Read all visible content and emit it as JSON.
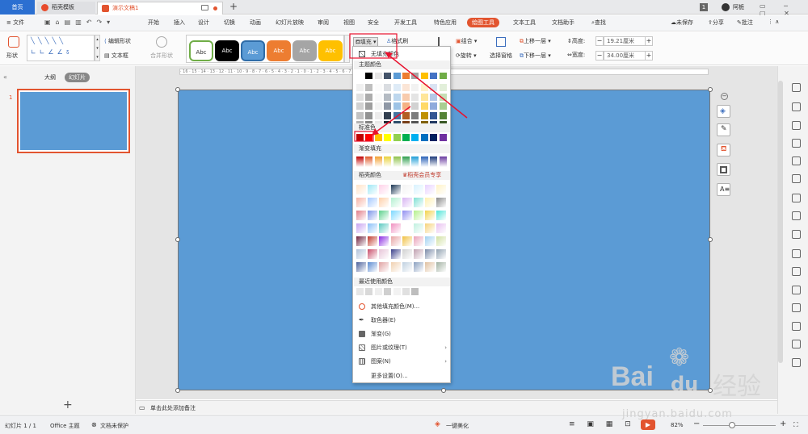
{
  "tabs": {
    "home": "首页",
    "template": "稻壳模板",
    "doc": "演示文稿1",
    "new_tab": "+",
    "page_badge": "1",
    "user": "阿栀"
  },
  "menu": {
    "file": "≡ 文件",
    "items": [
      "开始",
      "插入",
      "设计",
      "切换",
      "动画",
      "幻灯片放映",
      "审阅",
      "视图",
      "安全",
      "开发工具",
      "特色应用"
    ],
    "active": "绘图工具",
    "after": [
      "文本工具",
      "文档助手"
    ],
    "search": "查找",
    "unsaved": "未保存",
    "share": "分享",
    "comment": "批注"
  },
  "ribbon": {
    "shape": "形状",
    "edit_shape": "编辑形状",
    "textbox": "文本框",
    "merge": "合并形状",
    "styles": [
      "Abc",
      "Abc",
      "Abc",
      "Abc",
      "Abc",
      "Abc"
    ],
    "fill": "填充",
    "format_painter": "格式刷",
    "group": "组合",
    "rotate": "旋转",
    "select_pane": "选择窗格",
    "bring_forward": "上移一层",
    "send_backward": "下移一层",
    "height_label": "高度:",
    "height_value": "19.21厘米",
    "width_label": "宽度:",
    "width_value": "34.00厘米"
  },
  "left_panel": {
    "outline_tab": "大纲",
    "slides_tab": "幻灯片",
    "slide_number": "1",
    "add": "+"
  },
  "notes": "单击此处添加备注",
  "status": {
    "slide": "幻灯片 1 / 1",
    "theme": "Office 主题",
    "protect": "文档未保护",
    "beautify": "一键美化",
    "zoom": "82%"
  },
  "ruler": "· 16 · 15 · 14 · 13 · 12 · 11 · 10 · 9 · 8 · 7 · 6 · 5 · 4 · 3 · 2 · 1 · 0 · 1 · 2 · 3 · 4 · 5 · 6 · 7 · 8 · 9 · 10 · 11 · 12 · 13 · 14 · 15 · 16 ·",
  "dropdown": {
    "no_fill": "无填充颜色",
    "theme_colors": "主题颜色",
    "standard_colors": "标准色",
    "gradient_fill": "渐变填充",
    "docer_colors": "稻壳颜色",
    "docer_vip": "稻壳会员专享",
    "recent_colors": "最近使用颜色",
    "more_colors": "其他填充颜色(M)...",
    "eyedropper": "取色器(E)",
    "gradient": "渐变(G)",
    "picture_texture": "图片或纹理(T)",
    "pattern": "图案(N)",
    "more_settings": "更多设置(O)..."
  },
  "colors": {
    "accent": "#e2542f",
    "slide_fill": "#5b9bd5",
    "tab_blue": "#2b6fd1",
    "annotation": "#e8112d"
  },
  "watermark": {
    "brand": "Bai",
    "paw": "du",
    "cn": "经验",
    "url": "jingyan.baidu.com"
  }
}
